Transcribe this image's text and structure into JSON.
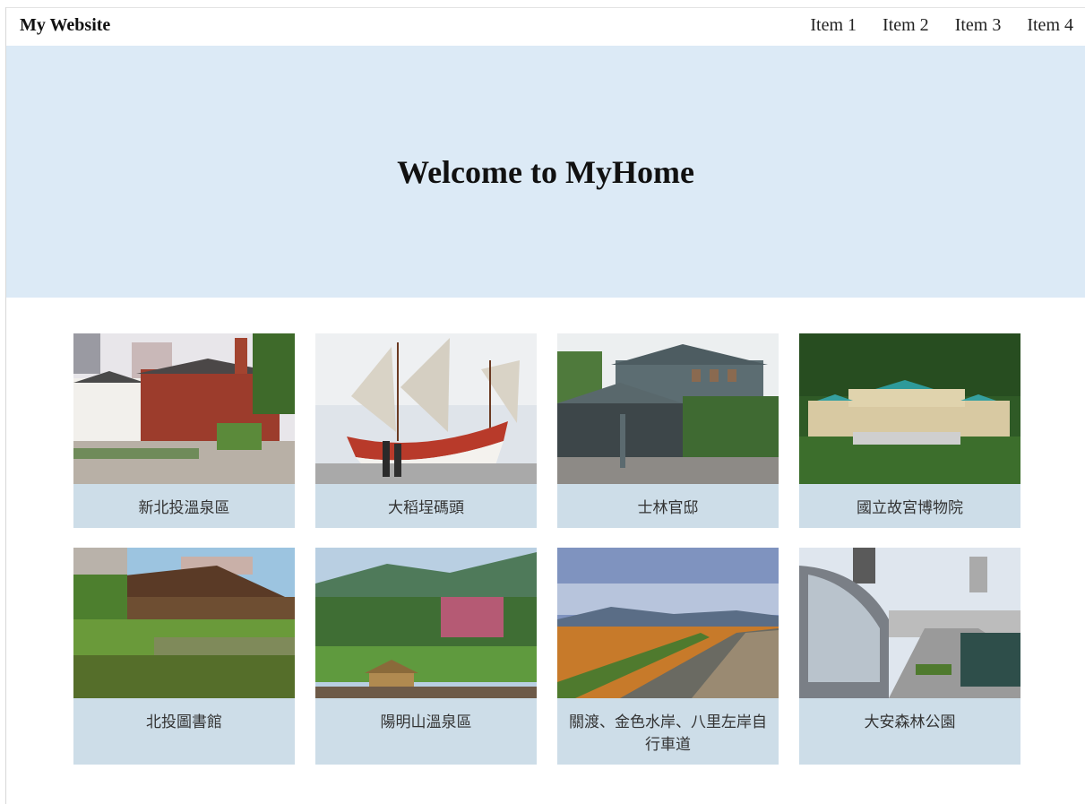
{
  "navbar": {
    "brand": "My Website",
    "items": [
      "Item 1",
      "Item 2",
      "Item 3",
      "Item 4"
    ]
  },
  "hero": {
    "title": "Welcome to MyHome"
  },
  "cards": [
    {
      "caption": "新北投溫泉區"
    },
    {
      "caption": "大稻埕碼頭"
    },
    {
      "caption": "士林官邸"
    },
    {
      "caption": "國立故宮博物院"
    },
    {
      "caption": "北投圖書館"
    },
    {
      "caption": "陽明山溫泉區"
    },
    {
      "caption": "關渡、金色水岸、八里左岸自行車道"
    },
    {
      "caption": "大安森林公園"
    }
  ]
}
